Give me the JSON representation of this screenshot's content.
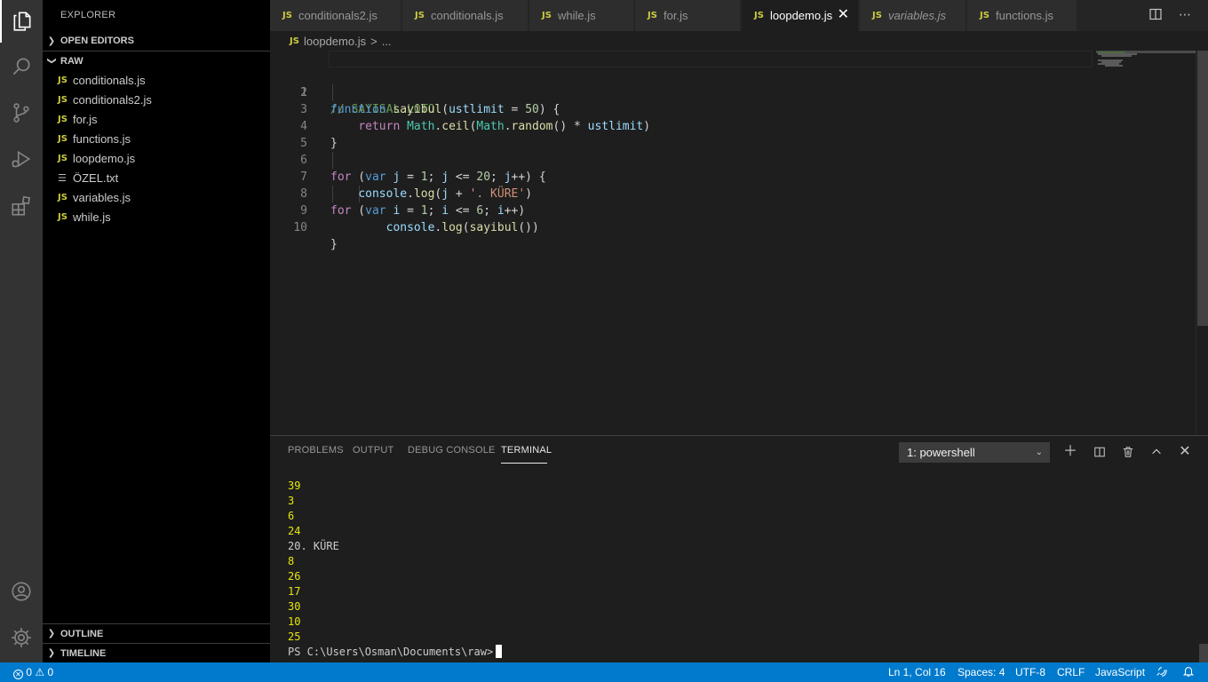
{
  "sidebar": {
    "title": "EXPLORER",
    "open_editors": "OPEN EDITORS",
    "folder": "RAW",
    "files": [
      {
        "name": "conditionals.js",
        "type": "js"
      },
      {
        "name": "conditionals2.js",
        "type": "js"
      },
      {
        "name": "for.js",
        "type": "js"
      },
      {
        "name": "functions.js",
        "type": "js"
      },
      {
        "name": "loopdemo.js",
        "type": "js"
      },
      {
        "name": "ÖZEL.txt",
        "type": "txt"
      },
      {
        "name": "variables.js",
        "type": "js"
      },
      {
        "name": "while.js",
        "type": "js"
      }
    ],
    "outline": "OUTLINE",
    "timeline": "TIMELINE"
  },
  "tabs": [
    {
      "label": "conditionals2.js",
      "badge": "JS"
    },
    {
      "label": "conditionals.js",
      "badge": "JS"
    },
    {
      "label": "while.js",
      "badge": "JS"
    },
    {
      "label": "for.js",
      "badge": "JS"
    },
    {
      "label": "loopdemo.js",
      "badge": "JS",
      "active": true
    },
    {
      "label": "variables.js",
      "badge": "JS",
      "italic": true
    },
    {
      "label": "functions.js",
      "badge": "JS"
    }
  ],
  "breadcrumb": {
    "badge": "JS",
    "file": "loopdemo.js",
    "sep": ">",
    "rest": "..."
  },
  "editor": {
    "line_numbers": [
      "1",
      "2",
      "3",
      "4",
      "5",
      "6",
      "7",
      "8",
      "9",
      "10"
    ]
  },
  "panel": {
    "tabs": [
      "PROBLEMS",
      "OUTPUT",
      "DEBUG CONSOLE",
      "TERMINAL"
    ],
    "active_tab": "TERMINAL",
    "terminal_select": "1: powershell",
    "lines": [
      {
        "text": "39",
        "kind": "num"
      },
      {
        "text": "3",
        "kind": "num"
      },
      {
        "text": "6",
        "kind": "num"
      },
      {
        "text": "24",
        "kind": "num"
      },
      {
        "text": "20. KÜRE",
        "kind": "text"
      },
      {
        "text": "8",
        "kind": "num"
      },
      {
        "text": "26",
        "kind": "num"
      },
      {
        "text": "17",
        "kind": "num"
      },
      {
        "text": "30",
        "kind": "num"
      },
      {
        "text": "10",
        "kind": "num"
      },
      {
        "text": "25",
        "kind": "num"
      }
    ],
    "prompt": "PS C:\\Users\\Osman\\Documents\\raw>"
  },
  "status": {
    "errors": "0",
    "warnings": "0",
    "position": "Ln 1, Col 16",
    "spaces": "Spaces: 4",
    "encoding": "UTF-8",
    "eol": "CRLF",
    "language": "JavaScript"
  },
  "colors": {
    "status_bar": "#007acc",
    "js_badge": "#cbcb41",
    "terminal_numbers": "#e5e510"
  }
}
